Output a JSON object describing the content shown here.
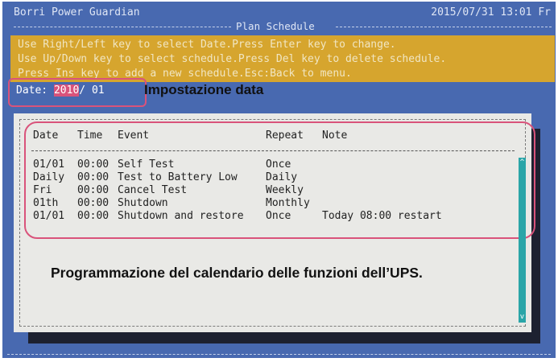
{
  "header": {
    "app_title": "Borri Power Guardian",
    "datetime": "2015/07/31 13:01 Fr",
    "section_title": "Plan Schedule"
  },
  "instructions": [
    "Use Right/Left key to select Date.Press Enter key to change.",
    "Use Up/Down key to select schedule.Press Del key to delete schedule.",
    "Press Ins key to add a new schedule.Esc:Back to menu."
  ],
  "date_field": {
    "label": "Date:",
    "year": "2010",
    "separator": "/",
    "month": "01"
  },
  "annotations": {
    "date_setting": "Impostazione data",
    "calendar_note": "Programmazione del calendario delle funzioni dell’UPS."
  },
  "schedule_table": {
    "columns": [
      "Date",
      "Time",
      "Event",
      "Repeat",
      "Note"
    ],
    "rows": [
      {
        "date": "01/01",
        "time": "00:00",
        "event": "Self Test",
        "repeat": "Once",
        "note": ""
      },
      {
        "date": "Daily",
        "time": "00:00",
        "event": "Test to Battery Low",
        "repeat": "Daily",
        "note": ""
      },
      {
        "date": "Fri",
        "time": "00:00",
        "event": "Cancel Test",
        "repeat": "Weekly",
        "note": ""
      },
      {
        "date": "01th",
        "time": "00:00",
        "event": "Shutdown",
        "repeat": "Monthly",
        "note": ""
      },
      {
        "date": "01/01",
        "time": "00:00",
        "event": "Shutdown and restore",
        "repeat": "Once",
        "note": "Today 08:00 restart"
      }
    ]
  },
  "scrollbar": {
    "up_glyph": "^",
    "down_glyph": "v"
  },
  "colors": {
    "screen_background": "#4869b0",
    "instruction_bar": "#d6a52e",
    "highlight": "#d9537b",
    "panel": "#e9e9e6",
    "scrollbar": "#2aa5a8"
  }
}
